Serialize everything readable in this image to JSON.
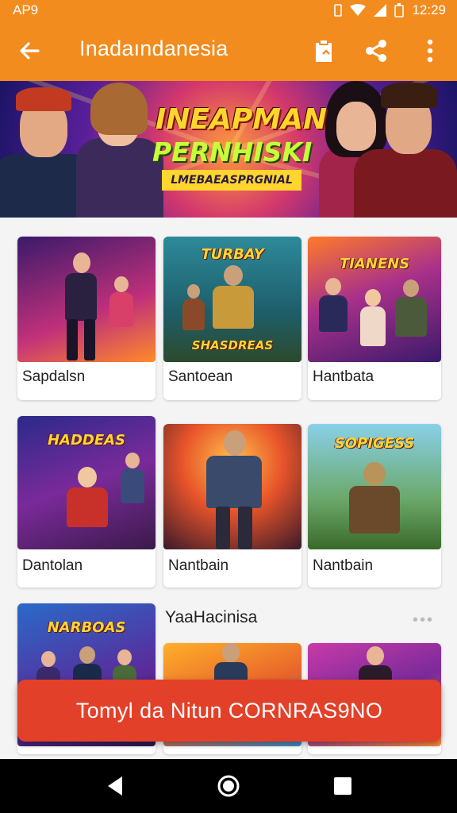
{
  "status_bar": {
    "left_text": "AP9",
    "time": "12:29",
    "icons": [
      "notification-icon",
      "wifi-icon",
      "signal-icon",
      "battery-icon"
    ]
  },
  "app_bar": {
    "title": "Inadaındanesia",
    "icons": [
      "back-arrow-icon",
      "clipboard-icon",
      "share-icon",
      "more-vert-icon"
    ],
    "background": "#f28c1f"
  },
  "banner": {
    "title": "INEAPMAN",
    "subtitle": "PERNHISKI",
    "tagline": "LMEBAEASPRGNIAL"
  },
  "grid": {
    "row1": [
      {
        "label": "Sapdalsn",
        "logo": ""
      },
      {
        "label": "Santoean",
        "logo": "TURBAY",
        "logo2": "SHASDREAS"
      },
      {
        "label": "Hantbata",
        "logo": "TIANENS"
      }
    ],
    "row2": [
      {
        "label": "Dantolan",
        "logo": "HADDEAS"
      },
      {
        "label": "Nantbain",
        "logo": ""
      },
      {
        "label": "Nantbain",
        "logo": "SOPIGESS"
      }
    ],
    "row3": [
      {
        "label": "",
        "logo": "NARBOAS"
      },
      {
        "label": "",
        "logo": ""
      },
      {
        "label": "",
        "logo": ""
      }
    ],
    "section_title": "YaaHacinisa",
    "more": "•••"
  },
  "cta": {
    "label": "Tomyl da Nitun  CORNRAS9NO",
    "color": "#e3402a"
  },
  "nav_bar": {
    "icons": [
      "nav-back-icon",
      "nav-home-icon",
      "nav-recents-icon"
    ]
  }
}
